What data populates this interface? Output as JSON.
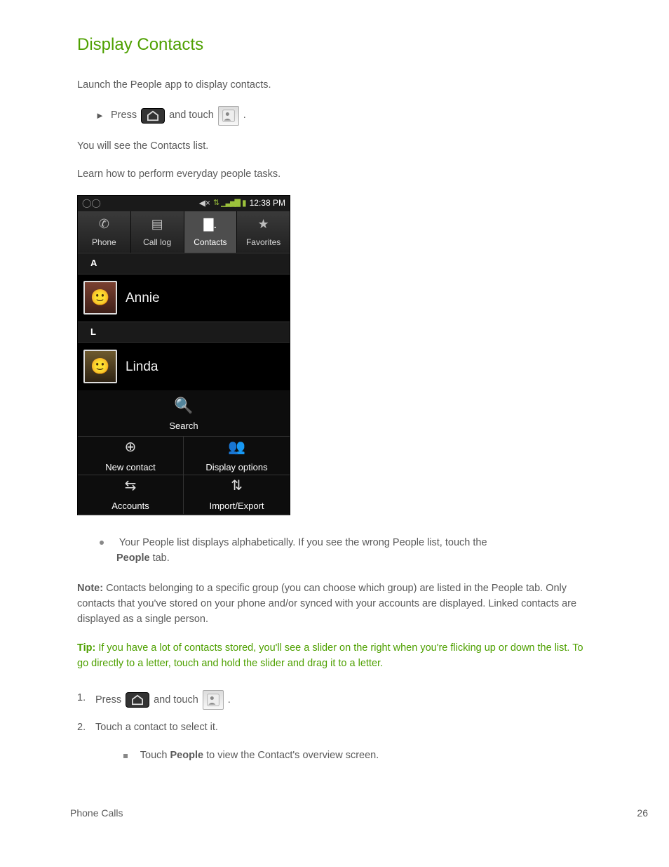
{
  "section": {
    "title": "Display Contacts",
    "intro": "Launch the People app to display contacts.",
    "bullets": {
      "press": "Press",
      "and_touch": "and touch",
      "period": ".",
      "after": "You will see the Contacts list."
    },
    "learn_intro": "Learn how to perform everyday people tasks.",
    "first_bullet": {
      "line1": "Your People list displays alphabetically. If you see the wrong People list, touch the",
      "line2_strong": "People",
      "line2_rest": " tab."
    },
    "note_label": "Note:",
    "note_text": " Contacts belonging to a specific group (you can choose which group) are listed in the People tab. Only contacts that you've stored on your phone and/or synced with your accounts are displayed. Linked contacts are displayed as a single person.",
    "tip_label": "Tip: ",
    "tip_text": "If you have a lot of contacts stored, you'll see a slider on the right when you're flicking up or down the list. To go directly to a letter, touch and hold the slider and drag it to a letter.",
    "step1": {
      "press": "Press",
      "and_touch": "and touch",
      "period": "."
    },
    "step2": "Touch a contact to select it.",
    "step2_sub_prefix": "Touch ",
    "step2_sub_strong": "People",
    "step2_sub_rest": " to view the Contact's overview screen.",
    "footer_left": "Phone Calls",
    "footer_right": "26"
  },
  "phone": {
    "time": "12:38 PM",
    "tabs": {
      "phone": "Phone",
      "calllog": "Call log",
      "contacts": "Contacts",
      "favorites": "Favorites"
    },
    "sec_a": "A",
    "sec_l": "L",
    "contacts": {
      "annie": "Annie",
      "linda": "Linda"
    },
    "menu": {
      "search": "Search",
      "newcontact": "New contact",
      "display": "Display options",
      "accounts": "Accounts",
      "importexport": "Import/Export"
    }
  }
}
